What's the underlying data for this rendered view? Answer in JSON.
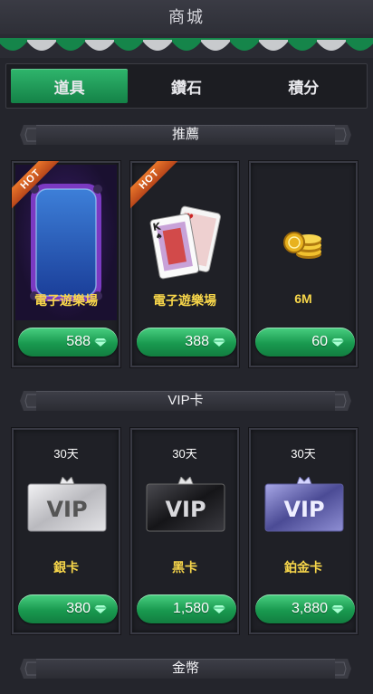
{
  "header": {
    "title": "商城"
  },
  "tabs": [
    {
      "label": "道具",
      "active": true
    },
    {
      "label": "鑽石",
      "active": false
    },
    {
      "label": "積分",
      "active": false
    }
  ],
  "sections": {
    "recommend": "推薦",
    "vip": "VIP卡",
    "gold": "金幣"
  },
  "recommend_items": [
    {
      "label": "電子遊樂場",
      "price": "588",
      "badge": "HOT",
      "icon": "slot-table-icon"
    },
    {
      "label": "電子遊樂場",
      "price": "388",
      "badge": "HOT",
      "icon": "playing-cards-icon"
    },
    {
      "label": "6M",
      "price": "60",
      "badge": "",
      "icon": "gold-coins-icon"
    }
  ],
  "vip_items": [
    {
      "days": "30天",
      "card_text": "VIP",
      "label": "銀卡",
      "price": "380",
      "color": "#c9c9cc"
    },
    {
      "days": "30天",
      "card_text": "VIP",
      "label": "黑卡",
      "price": "1,580",
      "color": "#2b2b2e"
    },
    {
      "days": "30天",
      "card_text": "VIP",
      "label": "鉑金卡",
      "price": "3,880",
      "color": "#6a6aa8"
    }
  ],
  "colors": {
    "accent_green": "#19994f",
    "label_yellow": "#f7d64a",
    "hot_orange": "#e0682a"
  }
}
